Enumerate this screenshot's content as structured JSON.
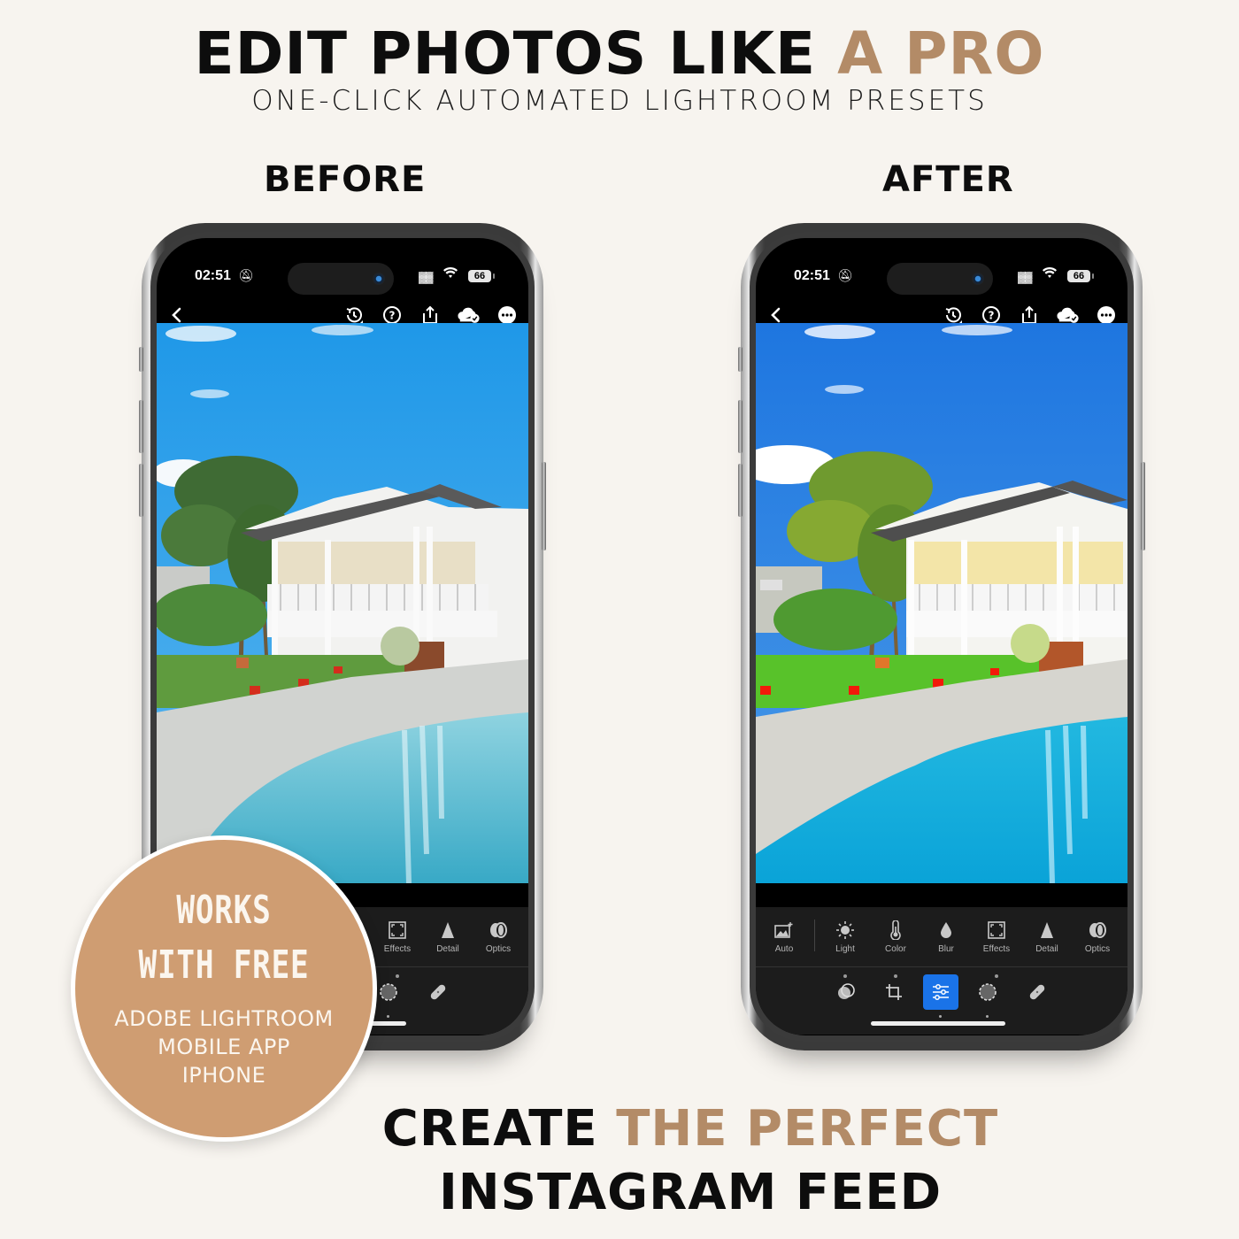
{
  "headline": {
    "main": "EDIT PHOTOS LIKE",
    "accent": "A PRO"
  },
  "subheadline": "ONE-CLICK AUTOMATED LIGHTROOM PRESETS",
  "labels": {
    "before": "BEFORE",
    "after": "AFTER"
  },
  "phones": [
    {
      "id": "before",
      "status_bar": {
        "time": "02:51",
        "battery": "66",
        "bell_icon": "bell-slash-icon",
        "signal_icon": "cellular-signal-icon",
        "wifi_icon": "wifi-icon"
      },
      "app_bar": {
        "back_icon": "chevron-left-icon",
        "actions": [
          "history-icon",
          "help-icon",
          "share-icon",
          "cloud-synced-icon",
          "more-icon"
        ]
      },
      "photo": {
        "description": "White Queenslander house with pool and palm trees",
        "edited": false
      },
      "tools": [
        {
          "label": "Effects",
          "icon": "vignette-icon"
        },
        {
          "label": "Detail",
          "icon": "triangle-icon"
        },
        {
          "label": "Optics",
          "icon": "lens-icon"
        }
      ],
      "modes": [
        "selective-mask-icon",
        "healing-icon"
      ]
    },
    {
      "id": "after",
      "status_bar": {
        "time": "02:51",
        "battery": "66",
        "bell_icon": "bell-slash-icon",
        "signal_icon": "cellular-signal-icon",
        "wifi_icon": "wifi-icon"
      },
      "app_bar": {
        "back_icon": "chevron-left-icon",
        "actions": [
          "history-icon",
          "help-icon",
          "share-icon",
          "cloud-synced-icon",
          "more-icon"
        ]
      },
      "photo": {
        "description": "Same house edited with vivid preset",
        "edited": true
      },
      "tools": [
        {
          "label": "Auto",
          "icon": "auto-icon"
        },
        {
          "label": "Light",
          "icon": "sun-icon"
        },
        {
          "label": "Color",
          "icon": "thermometer-icon"
        },
        {
          "label": "Blur",
          "icon": "droplet-icon"
        },
        {
          "label": "Effects",
          "icon": "vignette-icon"
        },
        {
          "label": "Detail",
          "icon": "triangle-icon"
        },
        {
          "label": "Optics",
          "icon": "lens-icon"
        }
      ],
      "modes": [
        "presets-icon",
        "crop-icon",
        "edit-sliders-icon",
        "selective-mask-icon",
        "healing-icon"
      ],
      "active_mode": "edit-sliders-icon"
    }
  ],
  "badge": {
    "line1": "WORKS",
    "line2": "WITH FREE",
    "line3": "ADOBE LIGHTROOM",
    "line4": "MOBILE APP",
    "line5": "IPHONE"
  },
  "footer": {
    "part1": "CREATE",
    "accent": "THE PERFECT",
    "line2": "INSTAGRAM FEED"
  },
  "colors": {
    "background": "#f7f4ef",
    "accent": "#b38b67",
    "badge": "#cf9d72",
    "active_tool": "#1a73e8"
  }
}
